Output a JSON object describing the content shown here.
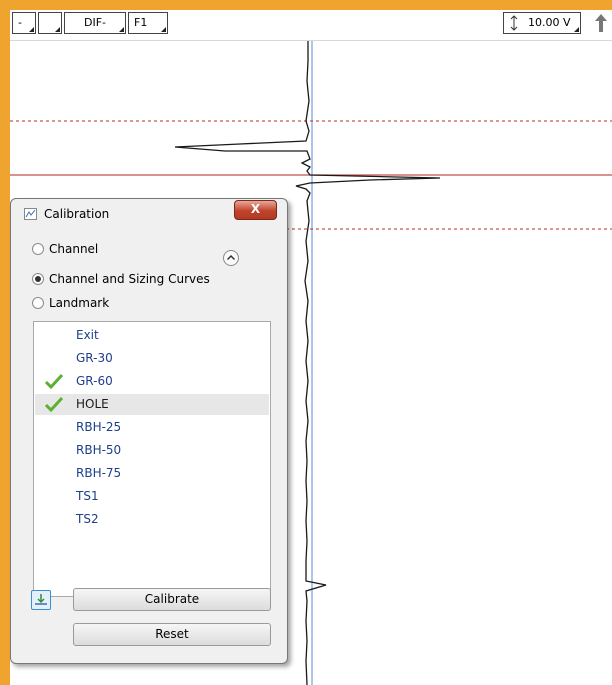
{
  "toolbar": {
    "buttons": [
      "-",
      "",
      "DIF-",
      "F1"
    ],
    "voltage": "10.00 V",
    "scale_icon": "vertical-arrows-icon",
    "up_icon": "up-arrow-icon"
  },
  "colors": {
    "frame": "#f0a430",
    "trace": "#1a1a1a",
    "center_line": "#8fb4e3",
    "marker_solid": "#c0504d",
    "marker_dashed": "#b0302a",
    "checkmark": "#5cb032"
  },
  "dialog": {
    "title": "Calibration",
    "close_label": "X",
    "radios": [
      {
        "label": "Channel",
        "checked": false
      },
      {
        "label": "Channel and Sizing Curves",
        "checked": true
      },
      {
        "label": "Landmark",
        "checked": false
      }
    ],
    "items": [
      {
        "label": "Exit",
        "checked": false,
        "selected": false
      },
      {
        "label": "GR-30",
        "checked": false,
        "selected": false
      },
      {
        "label": "GR-60",
        "checked": true,
        "selected": false
      },
      {
        "label": "HOLE",
        "checked": true,
        "selected": true
      },
      {
        "label": "RBH-25",
        "checked": false,
        "selected": false
      },
      {
        "label": "RBH-50",
        "checked": false,
        "selected": false
      },
      {
        "label": "RBH-75",
        "checked": false,
        "selected": false
      },
      {
        "label": "TS1",
        "checked": false,
        "selected": false
      },
      {
        "label": "TS2",
        "checked": false,
        "selected": false
      }
    ],
    "calibrate_label": "Calibrate",
    "reset_label": "Reset"
  }
}
